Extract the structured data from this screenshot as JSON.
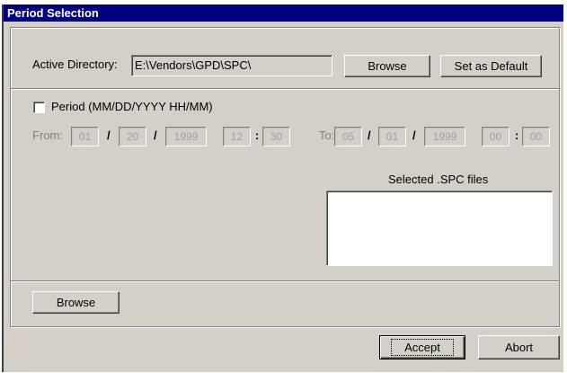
{
  "window": {
    "title": "Period Selection"
  },
  "directory": {
    "label": "Active Directory:",
    "value": "E:\\Vendors\\GPD\\SPC\\",
    "browse_label": "Browse",
    "default_label": "Set as Default"
  },
  "period": {
    "checkbox_label": "Period (MM/DD/YYYY HH/MM)",
    "checked": false,
    "from_label": "From:",
    "to_label": "To:",
    "from": {
      "month": "01",
      "day": "20",
      "year": "1999",
      "hour": "12",
      "minute": "30"
    },
    "to": {
      "month": "05",
      "day": "01",
      "year": "1999",
      "hour": "00",
      "minute": "00"
    },
    "date_sep": "/",
    "time_sep": ":"
  },
  "files": {
    "label": "Selected .SPC files",
    "items": []
  },
  "lower": {
    "browse_label": "Browse"
  },
  "footer": {
    "accept_label": "Accept",
    "abort_label": "Abort"
  }
}
